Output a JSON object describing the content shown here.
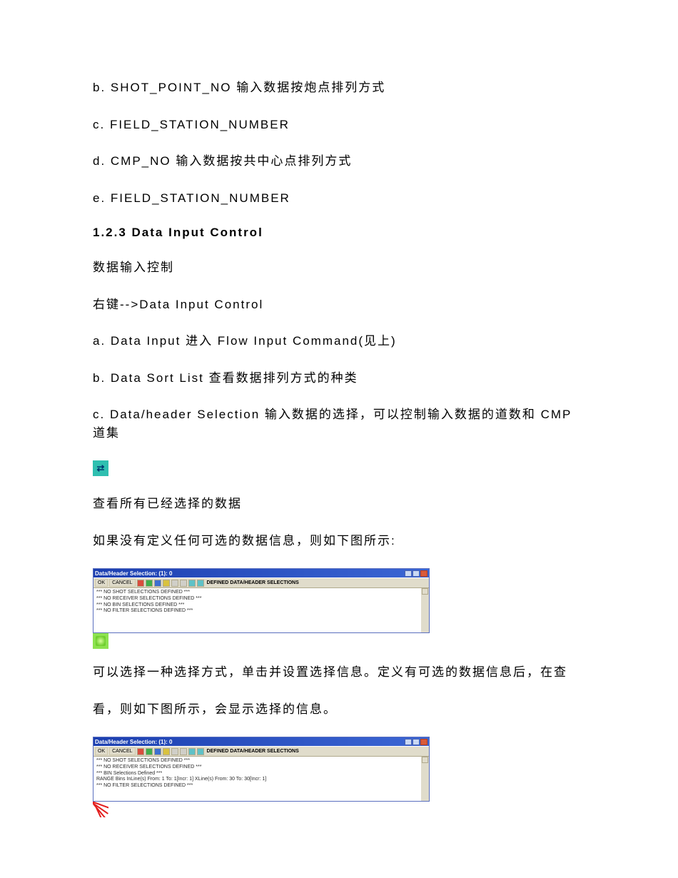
{
  "lines": {
    "b1": "b. SHOT_POINT_NO 输入数据按炮点排列方式",
    "c1": "c. FIELD_STATION_NUMBER",
    "d1": "d. CMP_NO 输入数据按共中心点排列方式",
    "e1": "e. FIELD_STATION_NUMBER",
    "sec": "1.2.3 Data Input Control",
    "p1": "数据输入控制",
    "p2": "右键-->Data Input Control",
    "a2": "a. Data Input 进入 Flow Input Command(见上)",
    "b2": "b. Data Sort List 查看数据排列方式的种类",
    "c2": "c. Data/header Selection 输入数据的选择，可以控制输入数据的道数和 CMP道集",
    "p3": "查看所有已经选择的数据",
    "p4": "如果没有定义任何可选的数据信息，则如下图所示:",
    "p5": "可以选择一种选择方式，单击并设置选择信息。定义有可选的数据信息后，在查",
    "p6": "看，则如下图所示，会显示选择的信息。"
  },
  "dialog1": {
    "title": "Data/Header Selection: (1): 0",
    "ok": "OK",
    "cancel": "CANCEL",
    "toolbar_label": "DEFINED DATA/HEADER SELECTIONS",
    "body": [
      "*** NO SHOT SELECTIONS DEFINED ***",
      "*** NO RECEIVER SELECTIONS DEFINED ***",
      "*** NO BIN SELECTIONS DEFINED ***",
      "*** NO FILTER SELECTIONS DEFINED ***"
    ]
  },
  "dialog2": {
    "title": "Data/Header Selection: (1): 0",
    "ok": "OK",
    "cancel": "CANCEL",
    "toolbar_label": "DEFINED DATA/HEADER SELECTIONS",
    "body": [
      "*** NO SHOT SELECTIONS DEFINED ***",
      "*** NO RECEIVER SELECTIONS DEFINED ***",
      "*** BIN Selections Defined ***",
      "RANGE Bins InLine(s) From: 1 To: 1[Incr: 1] XLine(s) From: 30 To: 30[Incr: 1]",
      " ",
      "*** NO FILTER SELECTIONS DEFINED ***"
    ]
  }
}
